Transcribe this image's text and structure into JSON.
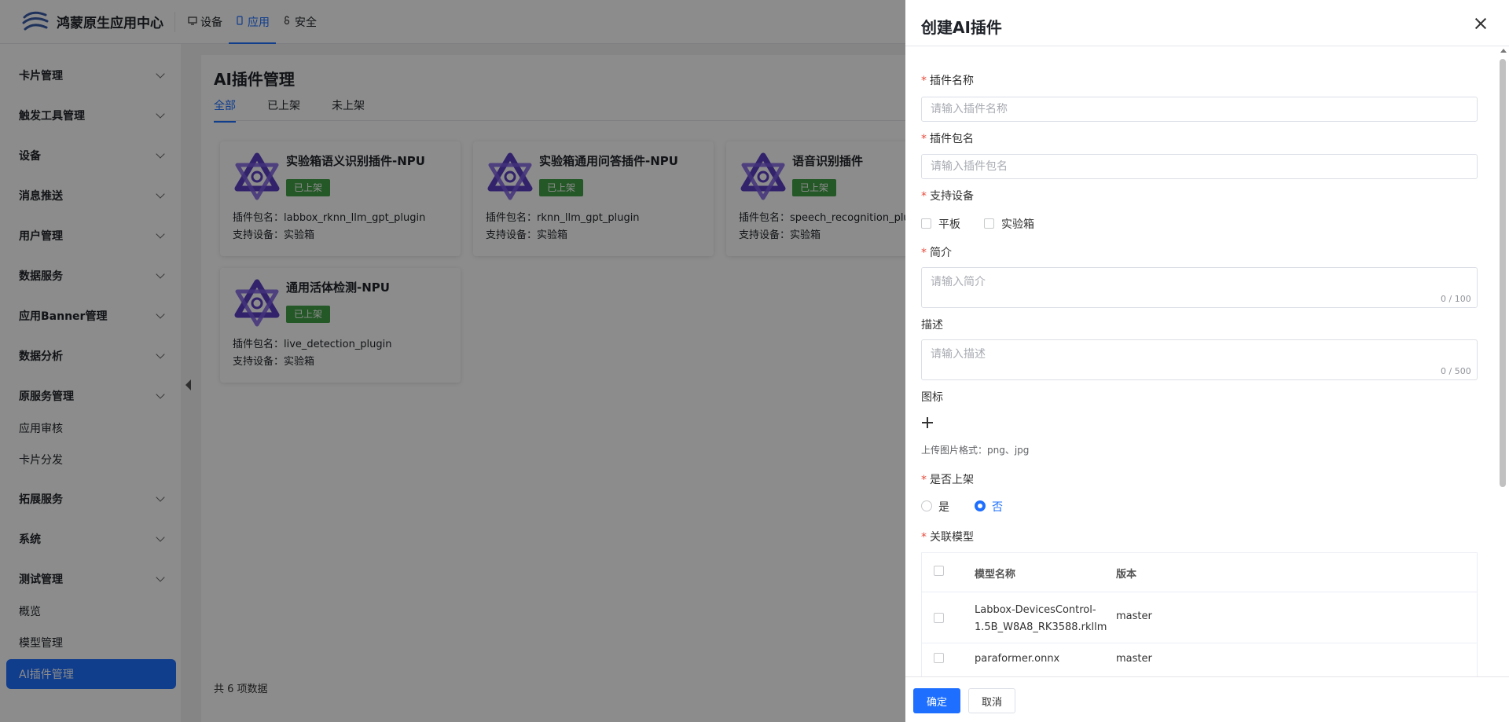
{
  "app": {
    "title": "鸿蒙原生应用中心",
    "nav": [
      {
        "label": "设备",
        "icon": "monitor-icon"
      },
      {
        "label": "应用",
        "icon": "phone-icon",
        "active": true
      },
      {
        "label": "安全",
        "icon": "lock-icon"
      }
    ]
  },
  "sidebar": {
    "items": [
      {
        "label": "卡片管理",
        "expandable": true
      },
      {
        "label": "触发工具管理",
        "expandable": true
      },
      {
        "label": "设备",
        "expandable": true
      },
      {
        "label": "消息推送",
        "expandable": true
      },
      {
        "label": "用户管理",
        "expandable": true
      },
      {
        "label": "数据服务",
        "expandable": true
      },
      {
        "label": "应用Banner管理",
        "expandable": true
      },
      {
        "label": "数据分析",
        "expandable": true
      },
      {
        "label": "原服务管理",
        "expandable": true
      },
      {
        "label": "应用审核",
        "expandable": false
      },
      {
        "label": "卡片分发",
        "expandable": false
      },
      {
        "label": "拓展服务",
        "expandable": true
      },
      {
        "label": "系统",
        "expandable": true
      },
      {
        "label": "测试管理",
        "expandable": true
      },
      {
        "label": "概览",
        "expandable": false
      },
      {
        "label": "模型管理",
        "expandable": false
      },
      {
        "label": "AI插件管理",
        "expandable": false,
        "active": true
      }
    ]
  },
  "main": {
    "title": "AI插件管理",
    "tabs": [
      {
        "label": "全部",
        "active": true
      },
      {
        "label": "已上架"
      },
      {
        "label": "未上架"
      }
    ],
    "cards": [
      {
        "title": "实验箱语义识别插件-NPU",
        "badge": "已上架",
        "pkg": "插件包名：labbox_rknn_llm_gpt_plugin",
        "device": "支持设备：实验箱"
      },
      {
        "title": "实验箱通用问答插件-NPU",
        "badge": "已上架",
        "pkg": "插件包名：rknn_llm_gpt_plugin",
        "device": "支持设备：实验箱"
      },
      {
        "title": "语音识别插件",
        "badge": "已上架",
        "pkg": "插件包名：speech_recognition_plu",
        "device": "支持设备：实验箱"
      },
      {
        "title": "通用活体检测-NPU",
        "badge": "已上架",
        "pkg": "插件包名：live_detection_plugin",
        "device": "支持设备：实验箱"
      }
    ],
    "total": "共 6 项数据"
  },
  "drawer": {
    "title": "创建AI插件",
    "fields": {
      "name": {
        "label": "插件名称",
        "placeholder": "请输入插件名称"
      },
      "package": {
        "label": "插件包名",
        "placeholder": "请输入插件包名"
      },
      "devices": {
        "label": "支持设备",
        "options": [
          "平板",
          "实验箱"
        ]
      },
      "intro": {
        "label": "简介",
        "placeholder": "请输入简介",
        "counter": "0 / 100"
      },
      "desc": {
        "label": "描述",
        "placeholder": "请输入描述",
        "counter": "0 / 500"
      },
      "icon": {
        "label": "图标",
        "hint": "上传图片格式：png、jpg"
      },
      "listed": {
        "label": "是否上架",
        "options": [
          "是",
          "否"
        ],
        "selected": "否"
      },
      "models": {
        "label": "关联模型",
        "columns": [
          "模型名称",
          "版本"
        ],
        "rows": [
          {
            "name": "Labbox-DevicesControl-1.5B_W8A8_RK3588.rkllm",
            "name_line1": "Labbox-DevicesControl-",
            "name_line2": "1.5B_W8A8_RK3588.rkllm",
            "version": "master"
          },
          {
            "name": "paraformer.onnx",
            "version": "master"
          }
        ]
      }
    },
    "confirm_label": "确定",
    "cancel_label": "取消"
  },
  "colors": {
    "accent": "#1e6fff",
    "badge": "#43a047",
    "required": "#e84c3d"
  }
}
